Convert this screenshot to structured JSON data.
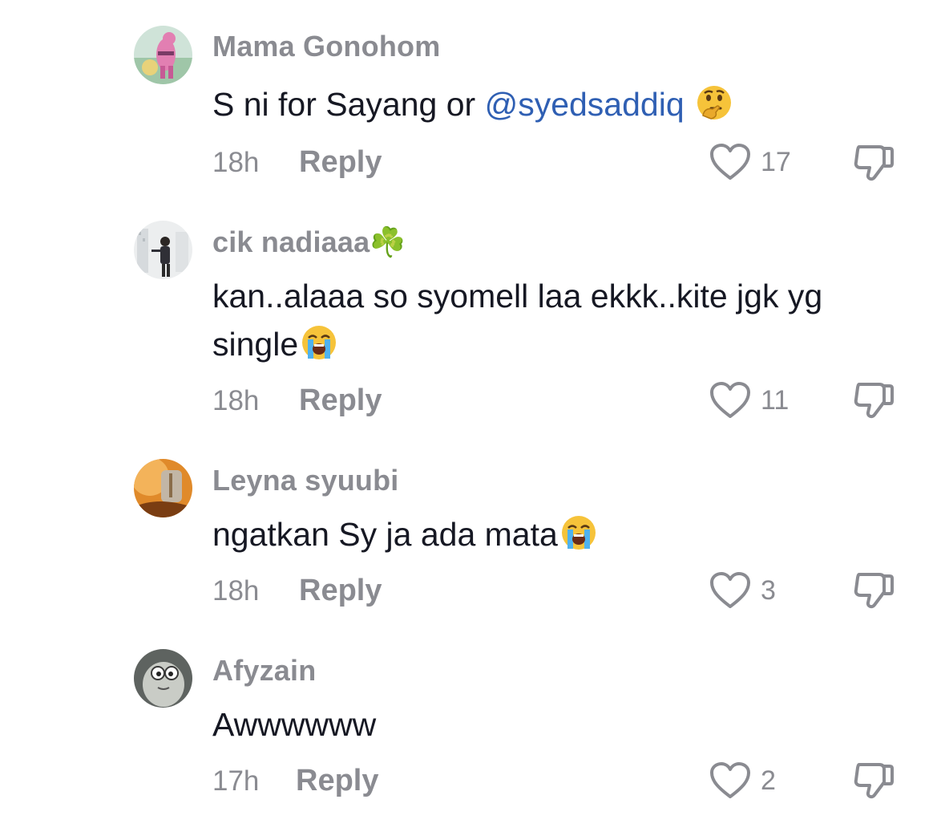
{
  "comments": [
    {
      "username": "Mama Gonohom",
      "text": "S ni for Sayang or ",
      "mention": "@syedsaddiq",
      "text_after": " ",
      "emoji": "thinking-face-icon",
      "time": "18h",
      "reply_label": "Reply",
      "likes": "17"
    },
    {
      "username": "cik nadiaaa☘️",
      "text": "kan..alaaa so syomell laa ekkk..kite jgk yg single",
      "emoji": "loudly-crying-face-icon",
      "time": "18h",
      "reply_label": "Reply",
      "likes": "11"
    },
    {
      "username": "Leyna syuubi",
      "text": "ngatkan Sy ja ada mata",
      "emoji": "loudly-crying-face-icon",
      "time": "18h",
      "reply_label": "Reply",
      "likes": "3"
    },
    {
      "username": "Afyzain",
      "text": "Awwwwww",
      "time": "17h",
      "reply_label": "Reply",
      "likes": "2"
    }
  ],
  "colors": {
    "secondary_text": "#8a8b91",
    "primary_text": "#161823",
    "mention": "#2f5fb3"
  }
}
